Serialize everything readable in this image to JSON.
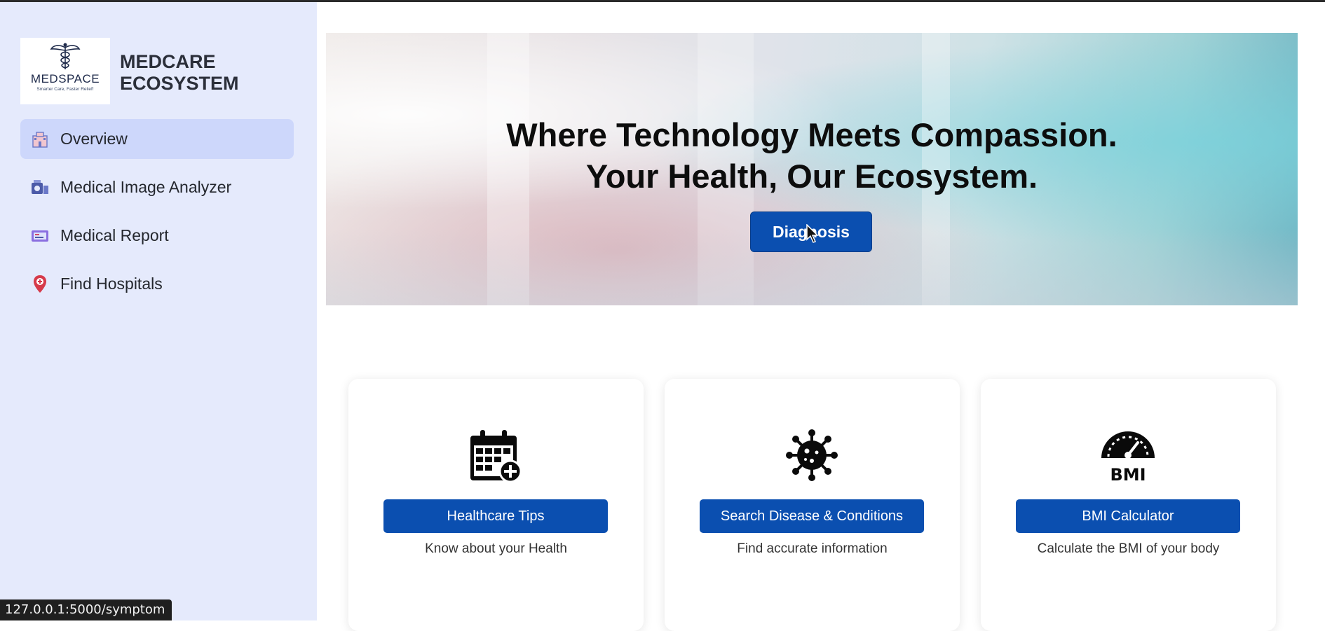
{
  "sidebar": {
    "logo": {
      "word": "MEDSPACE",
      "tagline": "Smarter Care, Faster Relief!"
    },
    "brand_line1": "MEDCARE",
    "brand_line2": "ECOSYSTEM",
    "items": [
      {
        "label": "Overview",
        "icon": "hospital-icon",
        "active": true
      },
      {
        "label": "Medical Image Analyzer",
        "icon": "scanner-icon",
        "active": false
      },
      {
        "label": "Medical Report",
        "icon": "report-icon",
        "active": false
      },
      {
        "label": "Find Hospitals",
        "icon": "location-pin-icon",
        "active": false
      }
    ]
  },
  "hero": {
    "line1": "Where Technology Meets Compassion.",
    "line2": "Your Health, Our Ecosystem.",
    "button_label": "Diagnosis"
  },
  "cards": [
    {
      "icon": "calendar-plus-icon",
      "button_label": "Healthcare Tips",
      "description": "Know about your Health"
    },
    {
      "icon": "virus-icon",
      "button_label": "Search Disease & Conditions",
      "description": "Find accurate information"
    },
    {
      "icon": "bmi-gauge-icon",
      "button_label": "BMI Calculator",
      "description": "Calculate the BMI of your body",
      "icon_text": "BMI"
    }
  ],
  "status_bar": {
    "url": "127.0.0.1:5000/symptom"
  },
  "colors": {
    "sidebar_bg": "#e5eafc",
    "active_item_bg": "#cdd7fb",
    "primary_button": "#0b4fb0"
  }
}
